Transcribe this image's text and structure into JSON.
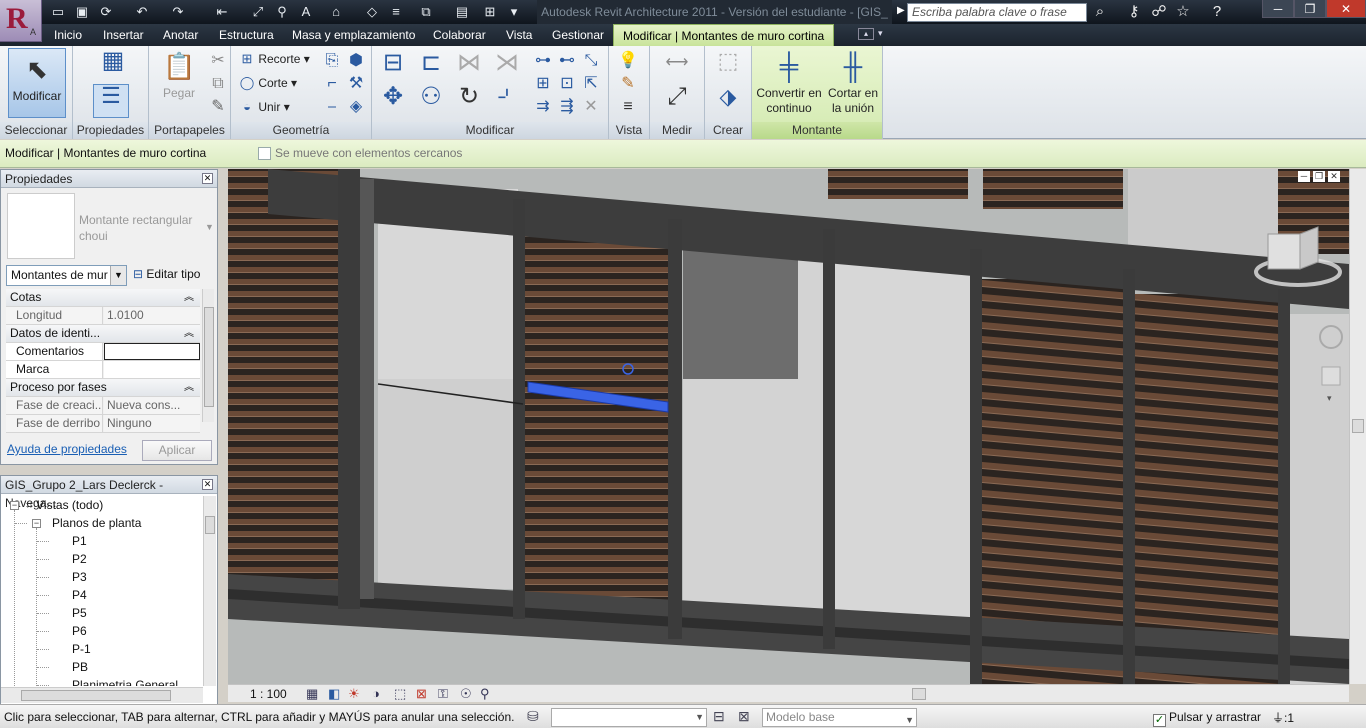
{
  "titlebar": {
    "app_icon_letter": "R",
    "app_icon_sub": "A",
    "title": "Autodesk Revit Architecture 2011 - Versión del estudiante - [GIS_",
    "search_placeholder": "Escriba palabra clave o frase",
    "help_symbol": "?"
  },
  "tabs": [
    {
      "label": "Inicio"
    },
    {
      "label": "Insertar"
    },
    {
      "label": "Anotar"
    },
    {
      "label": "Estructura"
    },
    {
      "label": "Masa y emplazamiento"
    },
    {
      "label": "Colaborar"
    },
    {
      "label": "Vista"
    },
    {
      "label": "Gestionar"
    },
    {
      "label": "Modificar | Montantes de muro cortina"
    }
  ],
  "ribbon": {
    "seleccionar": {
      "button": "Modificar",
      "label": "Seleccionar"
    },
    "propiedades": {
      "label": "Propiedades"
    },
    "portapapeles": {
      "paste": "Pegar",
      "label": "Portapapeles"
    },
    "geometria": {
      "recorte": "Recorte",
      "corte": "Corte",
      "unir": "Unir",
      "label": "Geometría"
    },
    "modificar": {
      "label": "Modificar"
    },
    "vista": {
      "label": "Vista"
    },
    "medir": {
      "label": "Medir"
    },
    "crear": {
      "label": "Crear"
    },
    "montante": {
      "convert_line1": "Convertir en",
      "convert_line2": "continuo",
      "cut_line1": "Cortar en",
      "cut_line2": "la unión",
      "label": "Montante"
    }
  },
  "options_bar": {
    "mode": "Modificar | Montantes de muro cortina",
    "move_with_nearby": "Se mueve con elementos cercanos",
    "move_with_nearby_checked": false
  },
  "properties": {
    "title": "Propiedades",
    "type_name": "Montante rectangular choui",
    "filter": "Montantes de mur",
    "edit_type": "Editar tipo",
    "groups": [
      {
        "name": "Cotas",
        "rows": [
          {
            "name": "Longitud",
            "value": "1.0100",
            "readonly": true
          }
        ]
      },
      {
        "name": "Datos de identi...",
        "rows": [
          {
            "name": "Comentarios",
            "value": "",
            "readonly": false
          },
          {
            "name": "Marca",
            "value": "",
            "readonly": false
          }
        ]
      },
      {
        "name": "Proceso por fases",
        "rows": [
          {
            "name": "Fase de creaci...",
            "value": "Nueva cons...",
            "readonly": true
          },
          {
            "name": "Fase de derribo",
            "value": "Ninguno",
            "readonly": true
          }
        ]
      }
    ],
    "help_link": "Ayuda de propiedades",
    "apply": "Aplicar"
  },
  "browser": {
    "title": "GIS_Grupo 2_Lars Declerck - Navega...",
    "root": "Vistas (todo)",
    "folder": "Planos de planta",
    "items": [
      "P1",
      "P2",
      "P3",
      "P4",
      "P5",
      "P6",
      "P-1",
      "PB",
      "Planimetria General"
    ]
  },
  "view": {
    "scale": "1 : 100"
  },
  "statusbar": {
    "hint": "Clic para seleccionar, TAB para alternar, CTRL para añadir y MAYÚS para anular una selección.",
    "workset": "",
    "design_option": "Modelo base",
    "press_drag": "Pulsar y arrastrar",
    "press_drag_checked": true,
    "filter_count": ":1"
  },
  "colors": {
    "active_tab": "#c8e39a",
    "selection_blue": "#3a64e6",
    "louvre_wood": "#6a4a37",
    "frame_dark": "#3c3c3c"
  }
}
